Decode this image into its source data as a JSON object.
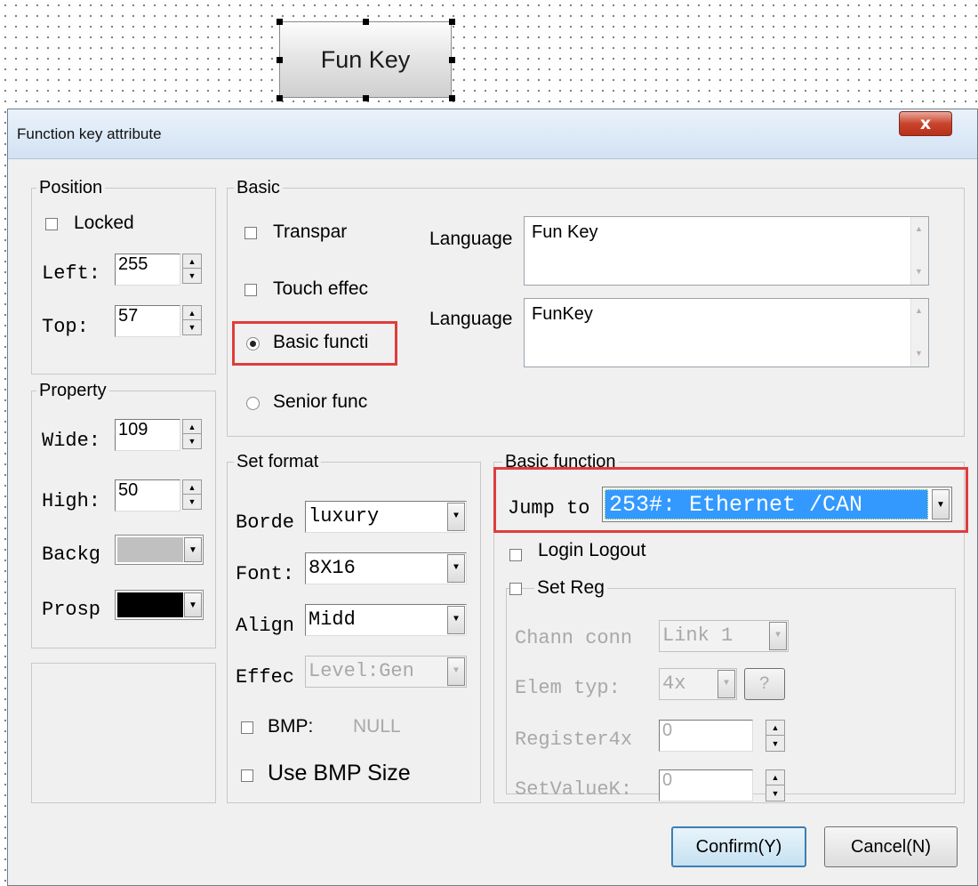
{
  "canvas": {
    "widget_label": "Fun Key"
  },
  "dialog": {
    "title": "Function key attribute",
    "close_label": "x",
    "position": {
      "legend": "Position",
      "locked_label": "Locked",
      "left_label": "Left:",
      "left_value": "255",
      "top_label": "Top:",
      "top_value": "57"
    },
    "property": {
      "legend": "Property",
      "wide_label": "Wide:",
      "wide_value": "109",
      "high_label": "High:",
      "high_value": "50",
      "background_label": "Backg",
      "background_color": "#c0c0c0",
      "prospect_label": "Prosp",
      "prospect_color": "#000000"
    },
    "basic": {
      "legend": "Basic",
      "transparent_label": "Transpar",
      "touch_effect_label": "Touch effec",
      "basic_function_label": "Basic functi",
      "senior_function_label": "Senior func",
      "language1_label": "Language",
      "language1_value": "Fun Key",
      "language2_label": "Language",
      "language2_value": "FunKey"
    },
    "set_format": {
      "legend": "Set format",
      "border_label": "Borde",
      "border_value": "luxury",
      "font_label": "Font:",
      "font_value": "8X16",
      "align_label": "Align",
      "align_value": "Midd",
      "effect_label": "Effec",
      "effect_value": "Level:Gen",
      "bmp_label": "BMP:",
      "bmp_value": "NULL",
      "use_bmp_size_label": "Use BMP Size"
    },
    "basic_function": {
      "legend": "Basic function",
      "jump_label": "Jump to",
      "jump_value": "253#: Ethernet /CAN",
      "login_logout_label": "Login Logout",
      "set_reg_label": "Set Reg",
      "channel_label": "Chann conn",
      "channel_value": "Link 1",
      "elem_label": "Elem typ:",
      "elem_value": "4x",
      "elem_help": "?",
      "register_label": "Register4x",
      "register_value": "0",
      "setvalue_label": "SetValueK:",
      "setvalue_value": "0"
    },
    "buttons": {
      "confirm": "Confirm(Y)",
      "cancel": "Cancel(N)"
    }
  }
}
